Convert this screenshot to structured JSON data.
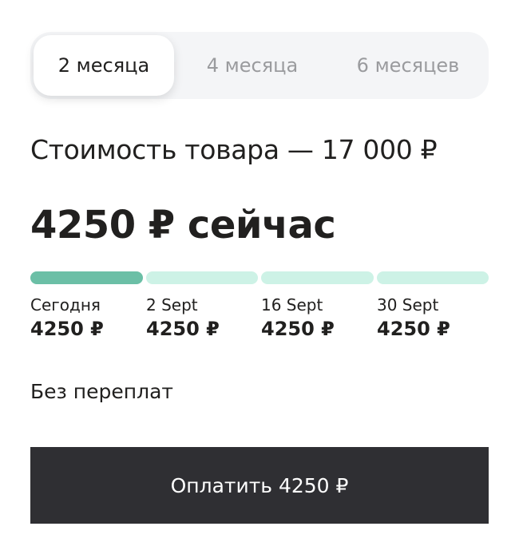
{
  "tabs": [
    {
      "label": "2 месяца",
      "active": true
    },
    {
      "label": "4 месяца",
      "active": false
    },
    {
      "label": "6 месяцев",
      "active": false
    }
  ],
  "product_cost": "Стоимость товара — 17 000 ₽",
  "pay_now": "4250 ₽ сейчас",
  "progress": {
    "paid_segments": 1,
    "total_segments": 4,
    "filled_color": "#6bbfa6",
    "empty_color": "#cdf2e6"
  },
  "schedule": [
    {
      "date": "Сегодня",
      "amount": "4250 ₽"
    },
    {
      "date": "2 Sept",
      "amount": "4250 ₽"
    },
    {
      "date": "16 Sept",
      "amount": "4250 ₽"
    },
    {
      "date": "30 Sept",
      "amount": "4250 ₽"
    }
  ],
  "no_overpay": "Без переплат",
  "pay_button": "Оплатить 4250 ₽"
}
